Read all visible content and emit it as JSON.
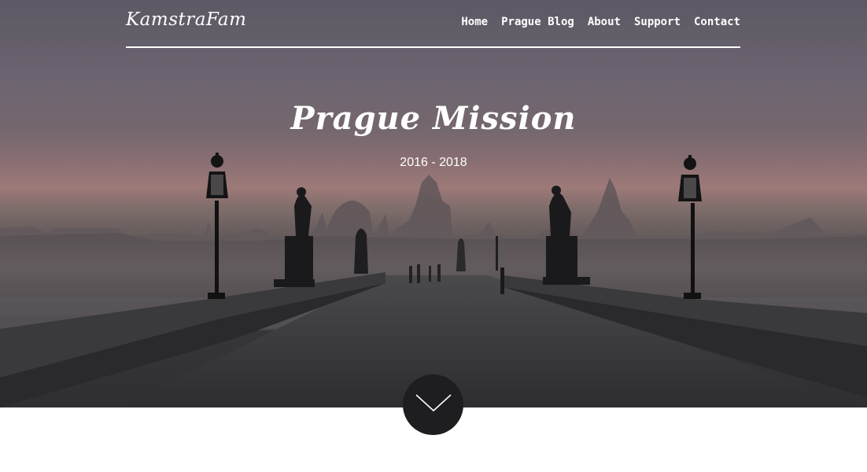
{
  "brand": {
    "name": "KamstraFam"
  },
  "nav": {
    "items": [
      {
        "label": "Home"
      },
      {
        "label": "Prague Blog"
      },
      {
        "label": "About"
      },
      {
        "label": "Support"
      },
      {
        "label": "Contact"
      }
    ]
  },
  "hero": {
    "title": "Prague Mission",
    "subtitle": "2016 - 2018",
    "background_image": "charles-bridge-prague-dawn",
    "scroll_icon": "chevron-down-icon"
  },
  "colors": {
    "text": "#ffffff",
    "scroll_button": "#1e1d1f",
    "page_bg": "#ffffff"
  }
}
